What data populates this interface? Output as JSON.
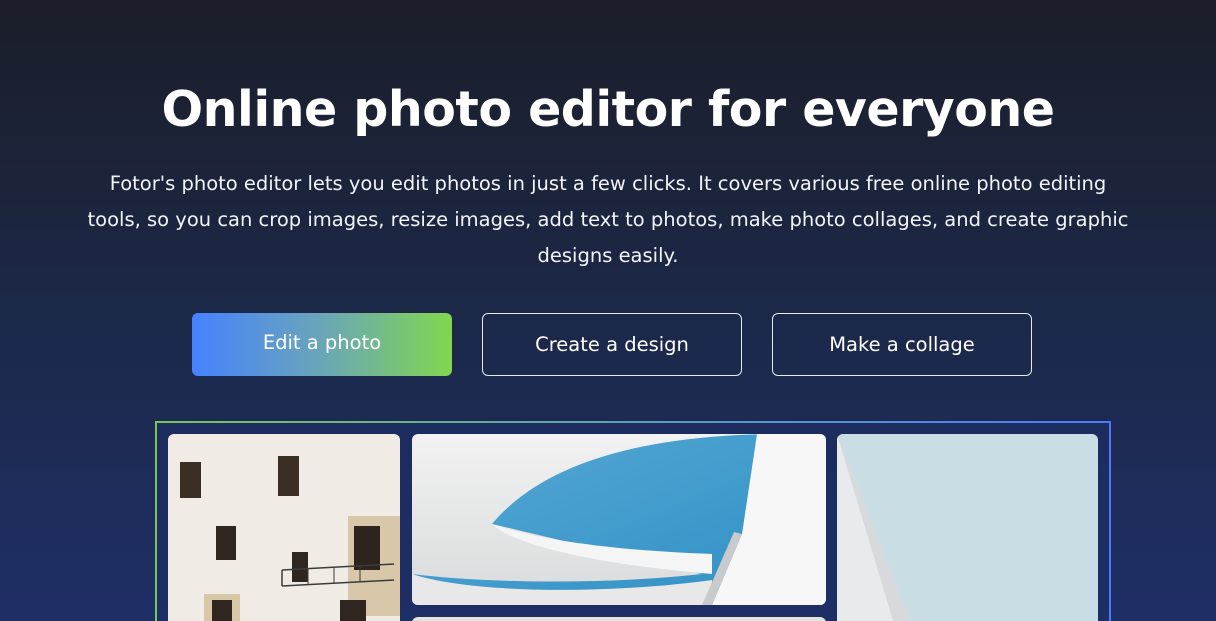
{
  "hero": {
    "title": "Online photo editor for everyone",
    "description": "Fotor's photo editor lets you edit photos in just a few clicks. It covers various free online photo editing tools, so you can crop images, resize images, add text to photos, make photo collages, and create graphic designs easily."
  },
  "actions": {
    "edit_photo": "Edit a photo",
    "create_design": "Create a design",
    "make_collage": "Make a collage"
  },
  "colors": {
    "background_top": "#1b1e29",
    "background_bottom": "#1e2f66",
    "gradient_start": "#4582ff",
    "gradient_end": "#82d64e"
  }
}
